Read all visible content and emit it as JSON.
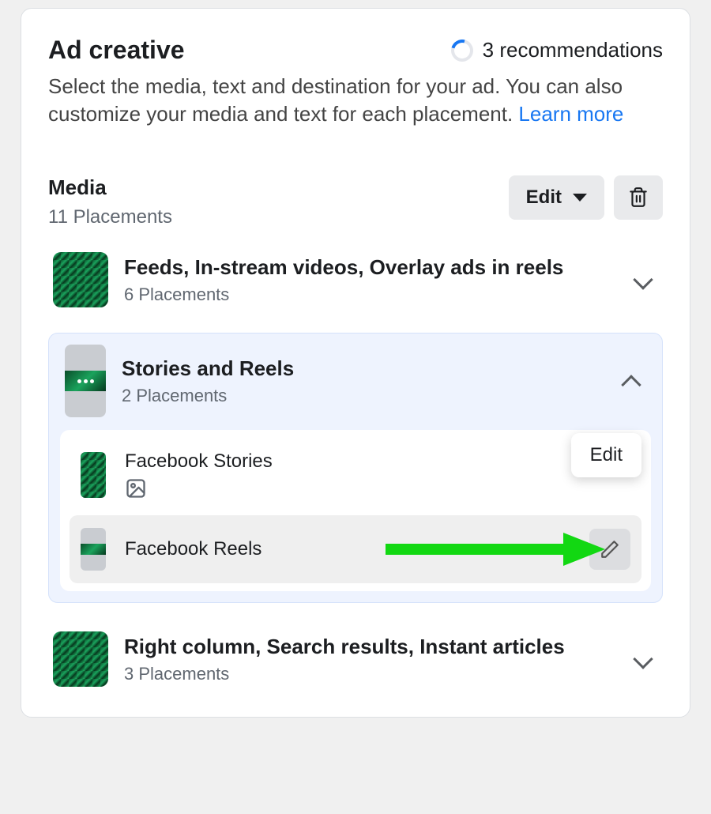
{
  "header": {
    "title": "Ad creative",
    "recommendations": "3 recommendations",
    "description_part1": "Select the media, text and destination for your ad. You can also customize your media and text for each placement. ",
    "learn_more": "Learn more"
  },
  "media": {
    "title": "Media",
    "subtitle": "11 Placements",
    "edit_label": "Edit"
  },
  "groups": [
    {
      "title": "Feeds, In-stream videos, Overlay ads in reels",
      "sub": "6 Placements"
    },
    {
      "title": "Stories and Reels",
      "sub": "2 Placements",
      "items": [
        {
          "label": "Facebook Stories"
        },
        {
          "label": "Facebook Reels"
        }
      ]
    },
    {
      "title": "Right column, Search results, Instant articles",
      "sub": "3 Placements"
    }
  ],
  "edit_popover": "Edit"
}
